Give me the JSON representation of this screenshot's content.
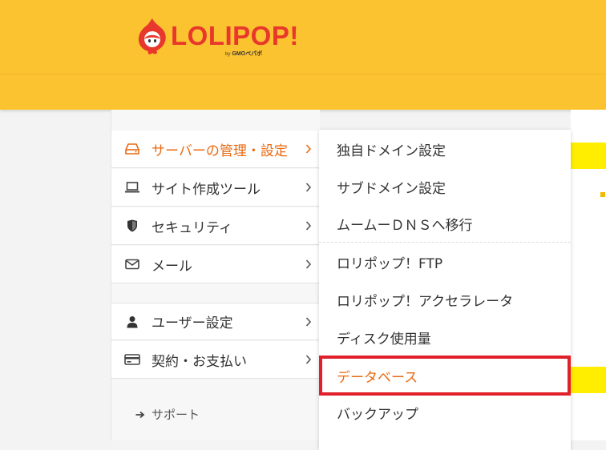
{
  "header": {
    "logo_text": "LOLIPOP!",
    "logo_by": "by",
    "logo_sub": "GMOペパボ",
    "brand_color": "#fcc331",
    "logo_color": "#e8372b"
  },
  "sidebar": {
    "items": [
      {
        "label": "サーバーの管理・設定",
        "icon": "server-icon",
        "active": true
      },
      {
        "label": "サイト作成ツール",
        "icon": "laptop-icon"
      },
      {
        "label": "セキュリティ",
        "icon": "shield-icon"
      },
      {
        "label": "メール",
        "icon": "envelope-icon"
      },
      {
        "label": "ユーザー設定",
        "icon": "user-icon"
      },
      {
        "label": "契約・お支払い",
        "icon": "credit-card-icon"
      }
    ],
    "support_label": "サポート",
    "active_color": "#ea6a12"
  },
  "dropdown": {
    "items": [
      {
        "label": "独自ドメイン設定"
      },
      {
        "label": "サブドメイン設定"
      },
      {
        "label": "ムームーＤＮＳへ移行"
      },
      {
        "label": "ロリポップ！FTP"
      },
      {
        "label": "ロリポップ！アクセラレータ"
      },
      {
        "label": "ディスク使用量"
      },
      {
        "label": "データベース",
        "highlighted": true
      },
      {
        "label": "バックアップ"
      }
    ],
    "highlight_border_color": "#e0202a"
  }
}
